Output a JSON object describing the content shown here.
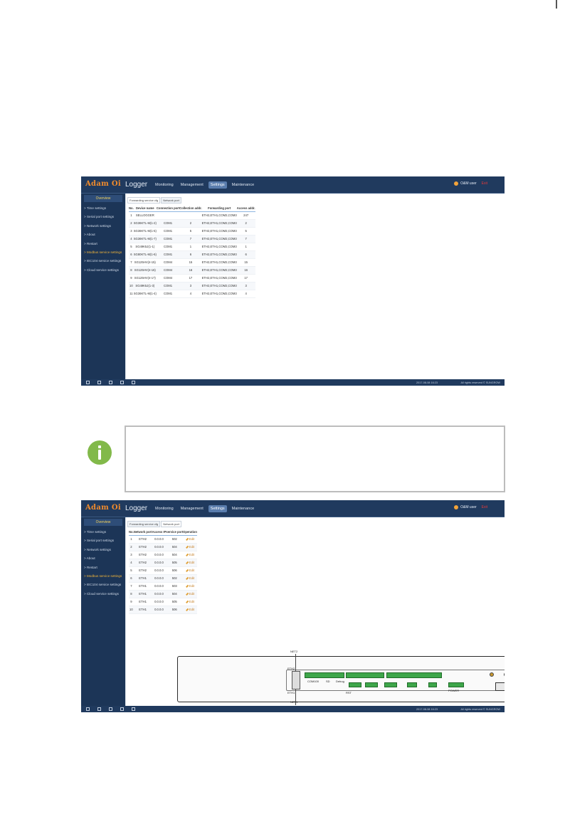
{
  "app": {
    "logo_main": "Adam",
    "logo_sep": " ",
    "logo_suffix": "Oi",
    "title": "Logger",
    "nav": [
      "Monitoring",
      "Management",
      "Settings",
      "Maintenance"
    ],
    "active_nav": "Settings",
    "user_label": "O&M user",
    "exit_label": "Exit",
    "sidebar_head": "Overview",
    "sidebar_items": [
      "> Time settings",
      "> Serial port settings",
      "> Network settings",
      "> About",
      "> Restart",
      "> Modbus service settings",
      "> IEC104 service settings",
      "> Cloud service settings"
    ],
    "status_time": "2017-08-08 16:23",
    "status_copy": "All rights reserved © SUNGROW"
  },
  "screen1": {
    "tabs": [
      "Forwarding service cfg",
      "Network port"
    ],
    "headers": [
      "No.",
      "Device name",
      "Connection port",
      "Collection addr.",
      "Forwarding port",
      "Access addr."
    ],
    "rows": [
      [
        "1",
        "SELLOGGER",
        "",
        "",
        "ETH2,ETH1,COM2,COM3",
        "247"
      ],
      [
        "2",
        "SG36KTL-M(1-2)",
        "COM1",
        "2",
        "ETH2,ETH1,COM2,COM3",
        "2"
      ],
      [
        "3",
        "SG36KTL-M(1-5)",
        "COM1",
        "5",
        "ETH2,ETH1,COM2,COM3",
        "5"
      ],
      [
        "4",
        "SG36KTL-M(1-7)",
        "COM1",
        "7",
        "ETH2,ETH1,COM2,COM3",
        "7"
      ],
      [
        "5",
        "SG49K5J(1-1)",
        "COM1",
        "1",
        "ETH2,ETH1,COM2,COM3",
        "1"
      ],
      [
        "6",
        "SG80KTL-M(1-6)",
        "COM1",
        "6",
        "ETH2,ETH1,COM2,COM3",
        "6"
      ],
      [
        "7",
        "SG125HV(4-15)",
        "COM4",
        "15",
        "ETH2,ETH1,COM2,COM3",
        "15"
      ],
      [
        "8",
        "SG125HV(4-16)",
        "COM4",
        "16",
        "ETH2,ETH1,COM2,COM3",
        "16"
      ],
      [
        "9",
        "SG125HV(4-17)",
        "COM4",
        "17",
        "ETH2,ETH1,COM2,COM3",
        "17"
      ],
      [
        "10",
        "SG49K5J(1-3)",
        "COM1",
        "3",
        "ETH2,ETH1,COM2,COM3",
        "3"
      ],
      [
        "11",
        "SG36KTL-M(1-4)",
        "COM1",
        "4",
        "ETH2,ETH1,COM2,COM3",
        "4"
      ]
    ]
  },
  "screen2": {
    "tabs": [
      "Forwarding service cfg",
      "Network port"
    ],
    "headers": [
      "No.",
      "Network port",
      "Access IP",
      "service port",
      "Operation"
    ],
    "operation_label": "Edit",
    "rows": [
      [
        "1",
        "ETH2",
        "0.0.0.0",
        "502",
        "Edit"
      ],
      [
        "2",
        "ETH2",
        "0.0.0.0",
        "504",
        "Edit"
      ],
      [
        "3",
        "ETH2",
        "0.0.0.0",
        "504",
        "Edit"
      ],
      [
        "4",
        "ETH2",
        "0.0.0.0",
        "505",
        "Edit"
      ],
      [
        "5",
        "ETH2",
        "0.0.0.0",
        "506",
        "Edit"
      ],
      [
        "6",
        "ETH1",
        "0.0.0.0",
        "502",
        "Edit"
      ],
      [
        "7",
        "ETH1",
        "0.0.0.0",
        "503",
        "Edit"
      ],
      [
        "8",
        "ETH1",
        "0.0.0.0",
        "504",
        "Edit"
      ],
      [
        "9",
        "ETH1",
        "0.0.0.0",
        "505",
        "Edit"
      ],
      [
        "10",
        "ETH1",
        "0.0.0.0",
        "506",
        "Edit"
      ]
    ],
    "device_labels": {
      "net2": "NET2",
      "net1": "NET1",
      "eth2": "ETH2",
      "eth1": "ETH1",
      "com100": "COM100",
      "sd": "SD",
      "debug": "Debug",
      "rst": "RST",
      "power": "POWER"
    }
  },
  "colors": {
    "topbar": "#203a5e",
    "sidebar": "#1c3557",
    "accent_orange": "#f08b2c",
    "active_item": "#f2b53a",
    "table_header_line": "#8fb6e0",
    "note_icon": "#82b94a"
  }
}
